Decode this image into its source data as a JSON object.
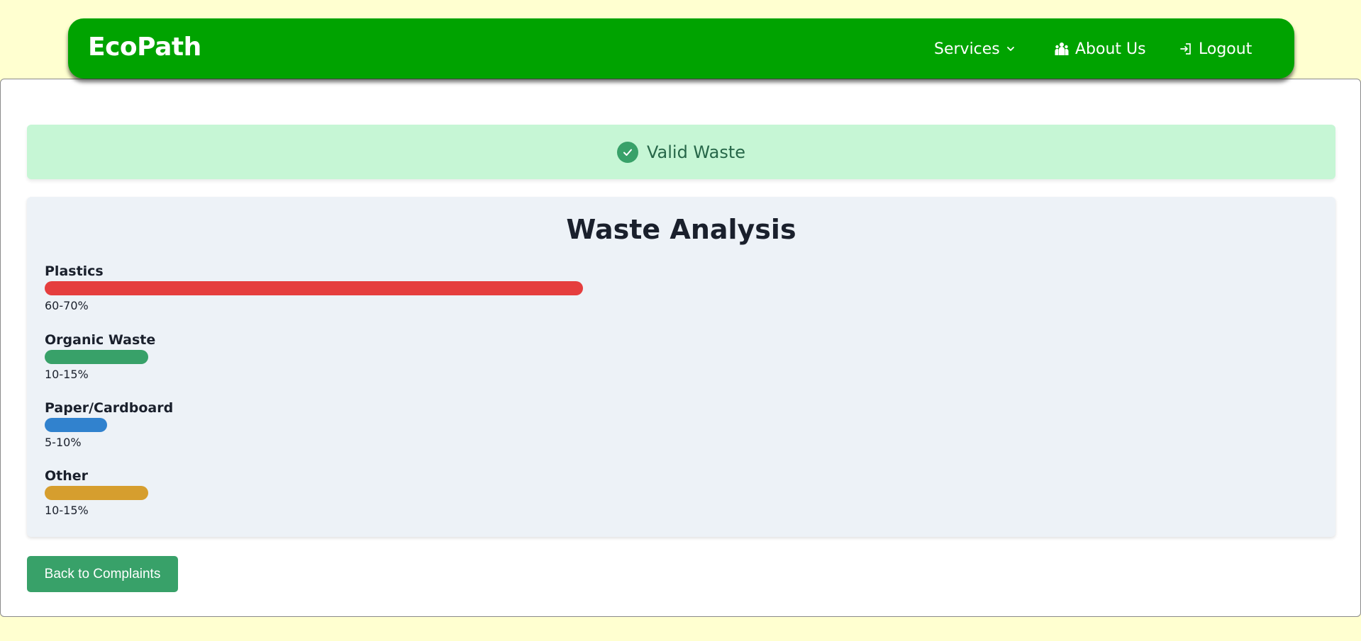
{
  "navbar": {
    "brand": "EcoPath",
    "services_label": "Services",
    "about_label": "About Us",
    "logout_label": "Logout",
    "icons": [
      "chevron-down-icon",
      "users-icon",
      "login-icon"
    ],
    "background_color": "#00a300"
  },
  "alert": {
    "text": "Valid Waste",
    "icon": "check-circle-icon",
    "background_color": "#c6f6d5",
    "text_color": "#276749"
  },
  "analysis": {
    "title": "Waste Analysis",
    "categories": [
      {
        "label": "Plastics",
        "range": "60-70%",
        "fill_percent": 65,
        "color": "#e53e3e"
      },
      {
        "label": "Organic Waste",
        "range": "10-15%",
        "fill_percent": 12.5,
        "color": "#38a169"
      },
      {
        "label": "Paper/Cardboard",
        "range": "5-10%",
        "fill_percent": 7.5,
        "color": "#3182ce"
      },
      {
        "label": "Other",
        "range": "10-15%",
        "fill_percent": 12.5,
        "color": "#d69e2e"
      }
    ]
  },
  "actions": {
    "back_label": "Back to Complaints",
    "back_color": "#38a169"
  },
  "page": {
    "background_color": "#ffffd0"
  }
}
